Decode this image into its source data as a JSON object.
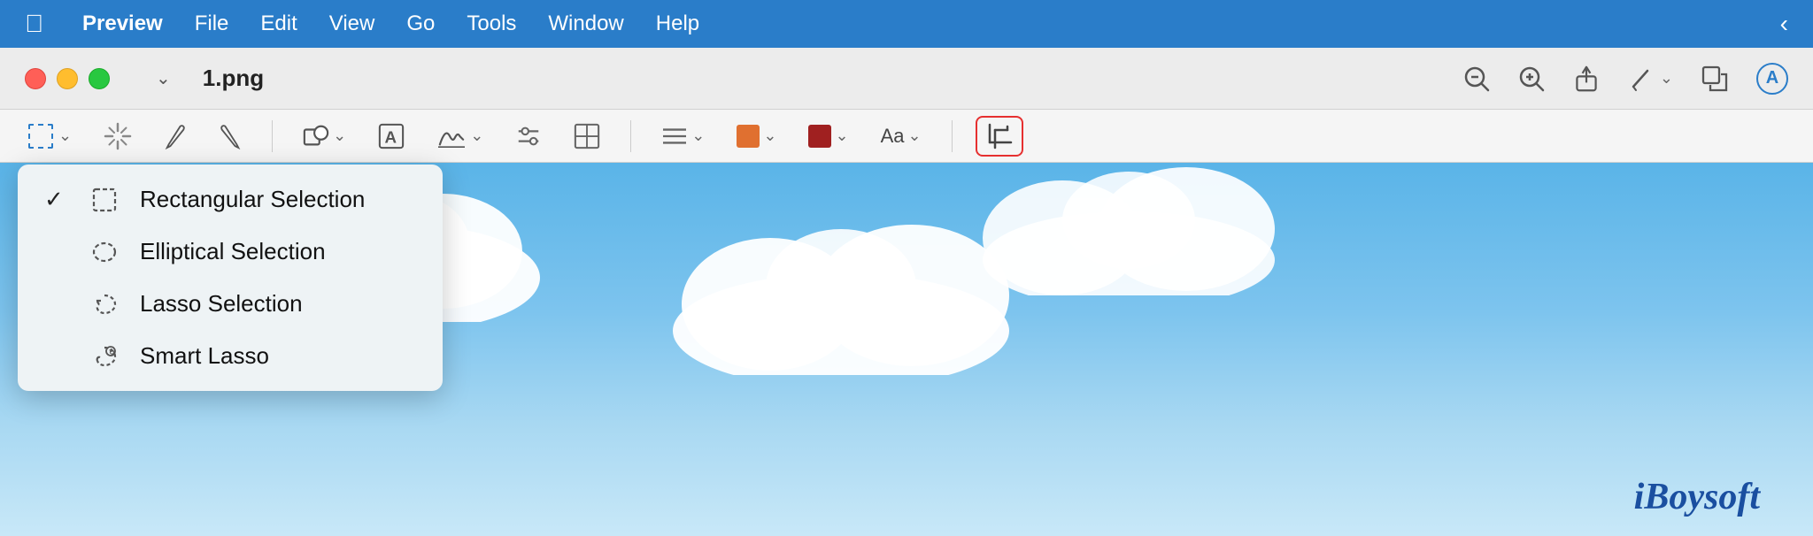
{
  "menubar": {
    "apple_label": "",
    "items": [
      {
        "label": "Preview",
        "active": true
      },
      {
        "label": "File"
      },
      {
        "label": "Edit"
      },
      {
        "label": "View"
      },
      {
        "label": "Go"
      },
      {
        "label": "Tools"
      },
      {
        "label": "Window"
      },
      {
        "label": "Help"
      }
    ],
    "chevron": "‹"
  },
  "titlebar": {
    "filename": "1.png",
    "sidebar_toggle_label": "sidebar-toggle"
  },
  "toolbar": {
    "selection_dropdown_label": "selection-dropdown",
    "aa_label": "Aa",
    "crop_label": "crop"
  },
  "dropdown": {
    "items": [
      {
        "id": "rectangular",
        "label": "Rectangular Selection",
        "checked": true,
        "icon": "rect"
      },
      {
        "id": "elliptical",
        "label": "Elliptical Selection",
        "checked": false,
        "icon": "ellipse"
      },
      {
        "id": "lasso",
        "label": "Lasso Selection",
        "checked": false,
        "icon": "lasso"
      },
      {
        "id": "smart-lasso",
        "label": "Smart Lasso",
        "checked": false,
        "icon": "smart-lasso"
      }
    ]
  },
  "content": {
    "watermark": "iBoysoft"
  }
}
